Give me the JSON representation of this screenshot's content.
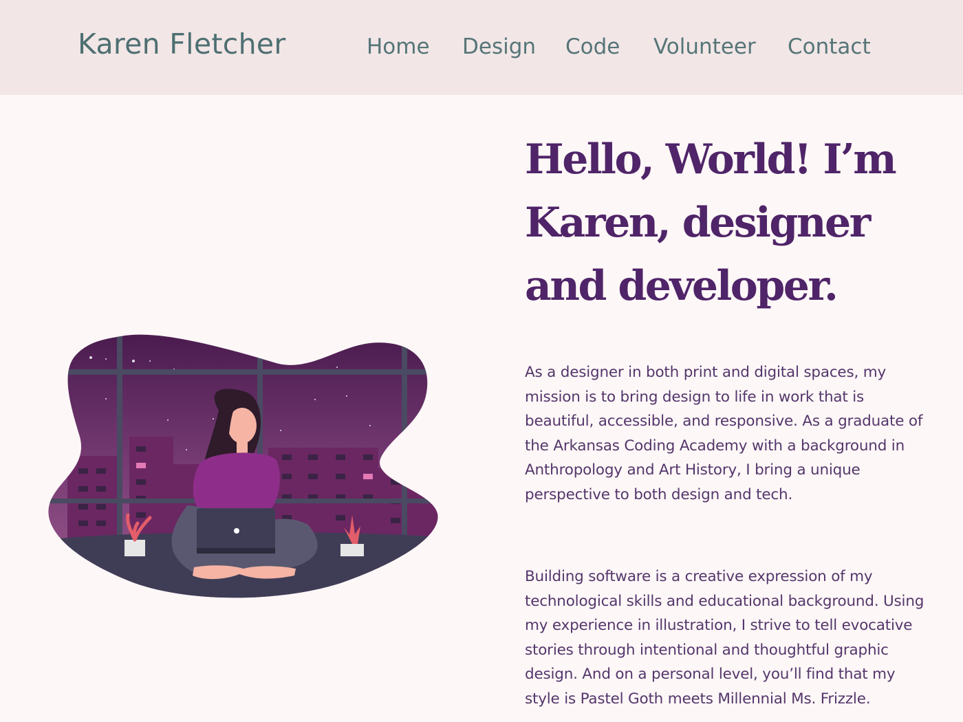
{
  "header": {
    "brand": "Karen Fletcher",
    "nav": [
      "Home",
      "Design",
      "Code",
      "Volunteer",
      "Contact"
    ]
  },
  "hero": {
    "headline": "Hello, World! I’m Karen, designer and developer.",
    "paragraphs": [
      "As a designer in both print and digital spaces, my mission is to bring design to life in work that is beautiful, accessible, and responsive. As a graduate of the Arkansas Coding Academy with a background in Anthropology and Art History, I bring a unique perspective to both design and tech.",
      "Building software is a creative expression of my technological skills and educational background. Using my experience in illustration, I strive to tell evocative stories through intentional and thoughtful graphic design. And on a personal level, you’ll find that my style is Pastel Goth meets Millennial Ms. Frizzle."
    ]
  },
  "colors": {
    "header_bg": "#f2e6e7",
    "page_bg": "#fdf7f7",
    "nav_text": "#567577",
    "headline": "#4f2468",
    "body_text": "#54366b"
  }
}
